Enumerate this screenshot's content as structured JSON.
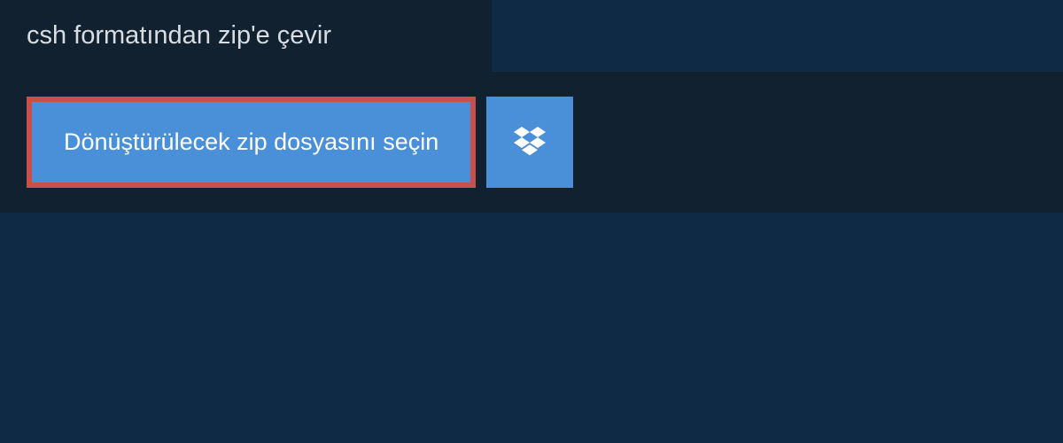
{
  "header": {
    "title": "csh formatından zip'e çevir"
  },
  "content": {
    "select_file_label": "Dönüştürülecek zip dosyasını seçin"
  },
  "colors": {
    "background": "#0e2a44",
    "panel": "#11212f",
    "button": "#4a90d9",
    "highlight_border": "#c94f4b",
    "text_light": "#d7dde2",
    "text_white": "#ffffff"
  }
}
